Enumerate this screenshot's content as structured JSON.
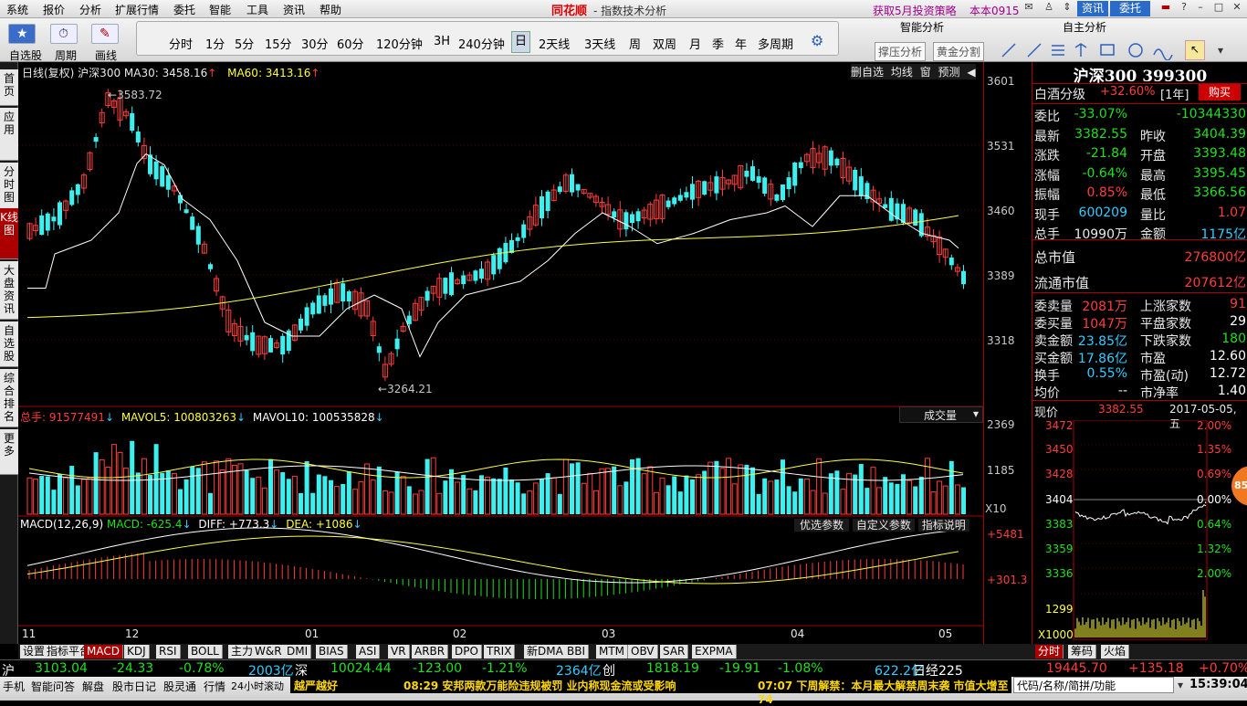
{
  "menu": {
    "items": [
      "系统",
      "报价",
      "分析",
      "扩展行情",
      "委托",
      "智能",
      "工具",
      "资讯",
      "帮助"
    ],
    "brand": "同花顺",
    "title": "- 指数技术分析",
    "promo": "获取5月投资策略",
    "version": "本本0915",
    "btn_news": "资讯",
    "btn_trade": "委托"
  },
  "toolbar": {
    "labels": [
      "自选股",
      "周期",
      "画线"
    ],
    "periods": [
      "分时",
      "1分",
      "5分",
      "15分",
      "30分",
      "60分",
      "120分钟",
      "3H",
      "240分钟",
      "日",
      "2天线",
      "3天线",
      "周",
      "双周",
      "月",
      "季",
      "年",
      "多周期"
    ],
    "active_period": "日",
    "smart_analysis": "智能分析",
    "self_analysis": "自主分析",
    "btn_pressure": "撑压分析",
    "btn_gold": "黄金分割"
  },
  "left_tabs": [
    "首页",
    "应用",
    "分时图",
    "K线图",
    "大盘资讯",
    "自选股",
    "综合排名",
    "更多"
  ],
  "chart_header": {
    "label": "日线(复权) 沪深300 MA30: 3458.16",
    "ma60": "MA60: 3413.16",
    "buttons": [
      "删自选",
      "均线",
      "窗",
      "预测"
    ]
  },
  "price_axis": [
    "3601",
    "3531",
    "3460",
    "3389",
    "3318"
  ],
  "annotations": {
    "high": "3583.72",
    "low": "3264.21"
  },
  "vol_header": {
    "total": "总手: 91577491",
    "mavol5": "MAVOL5: 100803263",
    "mavol10": "MAVOL10: 100535828",
    "dropdown": "成交量"
  },
  "vol_axis": [
    "2369",
    "1185",
    "X10"
  ],
  "macd_header": {
    "title": "MACD(12,26,9)",
    "macd": "MACD: -625.4",
    "diff": "DIFF: +773.3",
    "dea": "DEA: +1086",
    "buttons": [
      "优选参数",
      "自定义参数",
      "指标说明"
    ]
  },
  "macd_axis": [
    "+5481",
    "+301.3"
  ],
  "x_axis": [
    "11",
    "12",
    "01",
    "02",
    "03",
    "04",
    "05"
  ],
  "bottom_tabs": [
    "设置",
    "指标平台",
    "MACD",
    "KDJ",
    "RSI",
    "BOLL",
    "主力",
    "W&R",
    "DMI",
    "BIAS",
    "ASI",
    "VR",
    "ARBR",
    "DPO",
    "TRIX",
    "新DMA",
    "BBI",
    "MTM",
    "OBV",
    "SAR",
    "EXPMA"
  ],
  "active_bottom_tab": "MACD",
  "right_tabs": [
    "分时",
    "筹码",
    "火焰"
  ],
  "quote": {
    "title": "沪深300 399300",
    "sector": "白酒分级",
    "sector_chg": "+32.60%",
    "sector_period": "[1年]",
    "buy_btn": "购买",
    "rows": [
      [
        "委比",
        "-33.07%",
        "",
        "-10344330"
      ],
      [
        "最新",
        "3382.55",
        "昨收",
        "3404.39"
      ],
      [
        "涨跌",
        "-21.84",
        "开盘",
        "3393.48"
      ],
      [
        "涨幅",
        "-0.64%",
        "最高",
        "3395.45"
      ],
      [
        "振幅",
        "0.85%",
        "最低",
        "3366.56"
      ],
      [
        "现手",
        "600209",
        "量比",
        "1.07"
      ],
      [
        "总手",
        "10990万",
        "金额",
        "1175亿"
      ]
    ],
    "mktcap_label": "总市值",
    "mktcap": "276800亿",
    "float_label": "流通市值",
    "float": "207612亿",
    "rows2": [
      [
        "委卖量",
        "2081万",
        "上涨家数",
        "91"
      ],
      [
        "委买量",
        "1047万",
        "平盘家数",
        "29"
      ],
      [
        "卖金额",
        "23.85亿",
        "下跌家数",
        "180"
      ],
      [
        "买金额",
        "17.86亿",
        "市盈",
        "12.60"
      ],
      [
        "换手",
        "0.55%",
        "市盈(动)",
        "12.72"
      ],
      [
        "均价",
        "--",
        "市净率",
        "1.40"
      ]
    ]
  },
  "mini": {
    "now_label": "现价",
    "now": "3382.55",
    "date": "2017-05-05,五",
    "left_axis": [
      "3472",
      "3450",
      "3428",
      "3404",
      "3383",
      "3359",
      "3336",
      "1299",
      "X1000"
    ],
    "right_axis": [
      "2.00%",
      "1.35%",
      "0.69%",
      "0.00%",
      "0.64%",
      "1.32%",
      "2.00%"
    ],
    "badge": "85"
  },
  "status": {
    "sh_label": "沪",
    "sh_val": "3103.04",
    "sh_chg": "-24.33",
    "sh_pct": "-0.78%",
    "sh_amt": "2003亿",
    "sz_label": "深",
    "sz_val": "10024.44",
    "sz_chg": "-123.00",
    "sz_pct": "-1.21%",
    "sz_amt": "2364亿",
    "cy_label": "创",
    "cy_val": "1818.19",
    "cy_chg": "-19.91",
    "cy_pct": "-1.08%",
    "cy_amt": "622.2亿",
    "rj_label": "日经225",
    "rj_val": "19445.70",
    "rj_chg": "+135.18",
    "rj_pct": "+0.70%"
  },
  "status2": {
    "items": [
      "手机",
      "智能问答",
      "解盘",
      "股市日记",
      "股灵通",
      "行情",
      "24小时滚动"
    ],
    "ticker1": "越严越好",
    "ticker2": "08:29 安邦两款万能险违规被罚 业内称现金流或受影响",
    "ticker3": "07:07 下周解禁：本月最大解禁周末袭 市值大增至74",
    "search": "代码/名称/简拼/功能",
    "clock": "15:39:04"
  },
  "colors": {
    "up": "#ff3c3c",
    "down": "#00e5ff",
    "ma30": "#ffffff",
    "ma60": "#ffff00",
    "border": "#aa0000"
  }
}
